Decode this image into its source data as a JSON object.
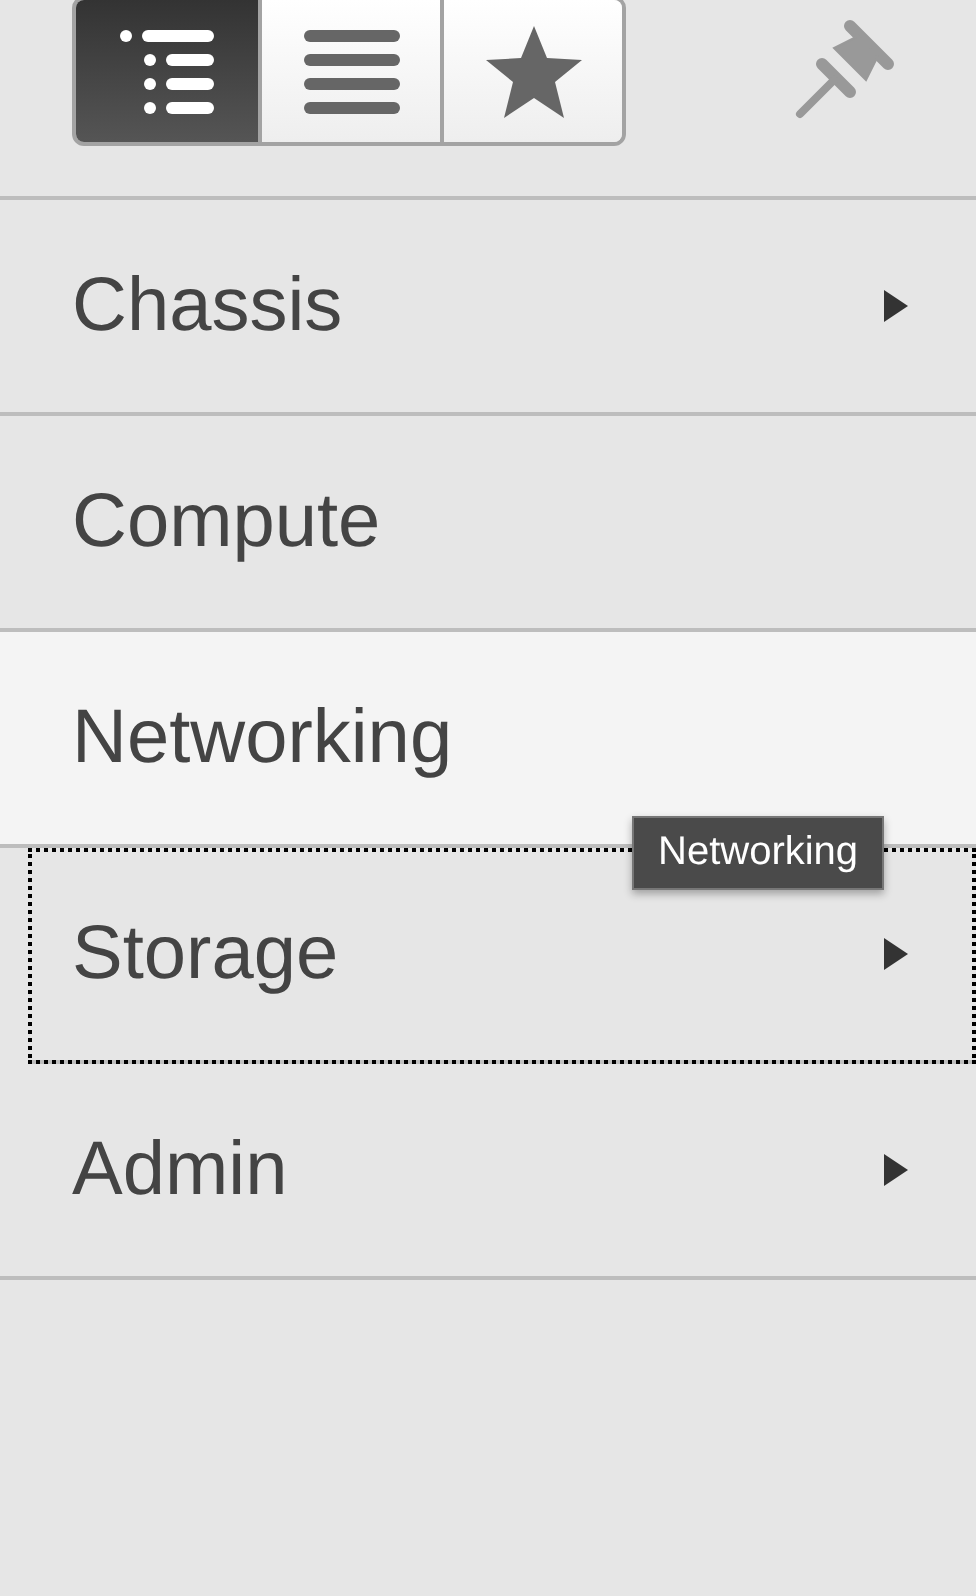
{
  "view_buttons": [
    {
      "kind": "tree",
      "selected": true
    },
    {
      "kind": "list",
      "selected": false
    },
    {
      "kind": "favorites",
      "selected": false
    }
  ],
  "menu_items": [
    {
      "label": "Chassis",
      "has_submenu": true,
      "hovered": false,
      "focused": false
    },
    {
      "label": "Compute",
      "has_submenu": false,
      "hovered": false,
      "focused": false
    },
    {
      "label": "Networking",
      "has_submenu": false,
      "hovered": true,
      "focused": false
    },
    {
      "label": "Storage",
      "has_submenu": true,
      "hovered": false,
      "focused": true
    },
    {
      "label": "Admin",
      "has_submenu": true,
      "hovered": false,
      "focused": false
    }
  ],
  "tooltip": {
    "text": "Networking"
  }
}
